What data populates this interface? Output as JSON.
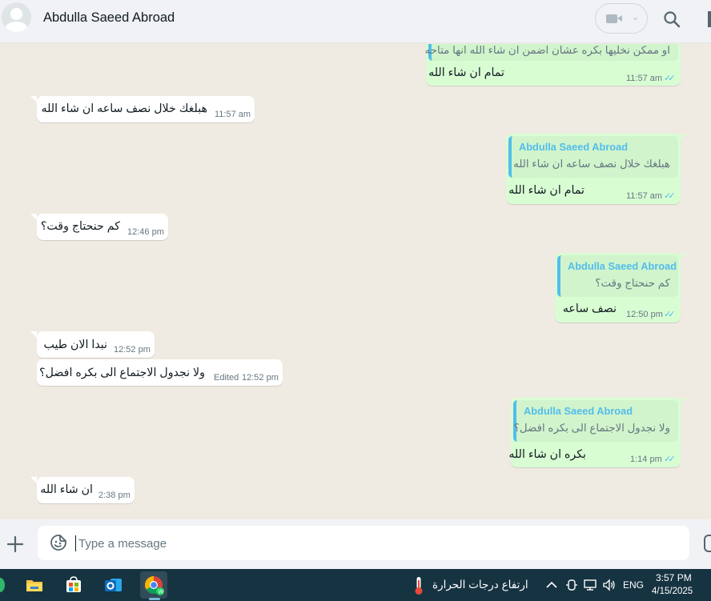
{
  "header": {
    "contact_name": "Abdulla Saeed Abroad",
    "icons": {
      "avatar": "default-avatar",
      "video_call": "video-camera-icon",
      "video_menu": "chevron-down-icon",
      "search": "search-icon"
    }
  },
  "messages": [
    {
      "direction": "out",
      "partial_quote": "او ممكن نخليها بكره عشان اضمن ان شاء الله انها متاحه",
      "text": "تمام ان شاء الله",
      "time": "11:57 am",
      "status": "read"
    },
    {
      "direction": "in",
      "text": "هبلغك خلال نصف ساعه ان شاء الله",
      "time": "11:57 am"
    },
    {
      "direction": "out",
      "quote_author": "Abdulla Saeed Abroad",
      "quote_text": "هبلغك خلال نصف ساعه ان شاء الله",
      "text": "تمام ان شاء الله",
      "time": "11:57 am",
      "status": "read"
    },
    {
      "direction": "in",
      "text": "كم حنحتاج وقت؟",
      "time": "12:46 pm"
    },
    {
      "direction": "out",
      "quote_author": "Abdulla Saeed Abroad",
      "quote_text": "كم حنحتاج وقت؟",
      "text": "نصف ساعه",
      "time": "12:50 pm",
      "status": "read"
    },
    {
      "direction": "in",
      "text": "نبدا الان طيب",
      "time": "12:52 pm"
    },
    {
      "direction": "in",
      "text": "ولا نجدول الاجتماع الى بكره افضل؟",
      "edited_label": "Edited",
      "time": "12:52 pm"
    },
    {
      "direction": "out",
      "quote_author": "Abdulla Saeed Abroad",
      "quote_text": "ولا نجدول الاجتماع الى بكره افضل؟",
      "text": "بكره ان شاء الله",
      "time": "1:14 pm",
      "status": "read"
    },
    {
      "direction": "in",
      "text": "ان شاء الله",
      "time": "2:38 pm"
    }
  ],
  "composer": {
    "placeholder": "Type a message",
    "value": "",
    "icons": {
      "attach": "plus-icon",
      "emoji": "sticker-emoji-icon",
      "voice": "microphone-icon"
    }
  },
  "taskbar": {
    "apps": [
      {
        "name": "file-explorer-icon"
      },
      {
        "name": "microsoft-store-icon"
      },
      {
        "name": "outlook-icon"
      },
      {
        "name": "chrome-whatsapp-icon",
        "active": true
      }
    ],
    "weather_text": "ارتفاع درجات الحرارة",
    "language": "ENG",
    "time": "3:57 PM",
    "date": "4/15/2025"
  },
  "colors": {
    "chat_bg": "#efeae2",
    "incoming_bubble": "#ffffff",
    "outgoing_bubble": "#d9fdd3",
    "quote_accent": "#53bdeb",
    "read_ticks": "#53bdeb",
    "header_bg": "#f0f2f5",
    "taskbar_bg": "#163341"
  }
}
